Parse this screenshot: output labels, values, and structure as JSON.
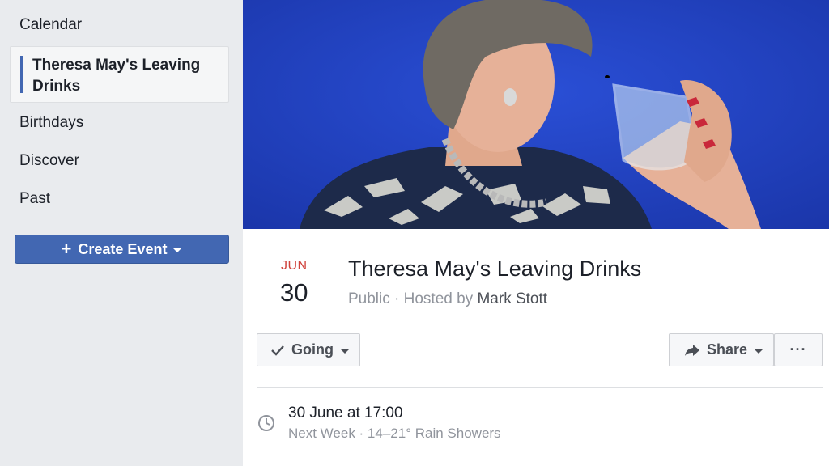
{
  "sidebar": {
    "items": [
      {
        "label": "Calendar"
      },
      {
        "label": "Theresa May's Leaving Drinks"
      },
      {
        "label": "Birthdays"
      },
      {
        "label": "Discover"
      },
      {
        "label": "Past"
      }
    ],
    "create_button": {
      "plus": "+",
      "label": "Create Event"
    }
  },
  "event": {
    "month": "JUN",
    "day": "30",
    "title": "Theresa May's Leaving Drinks",
    "privacy": "Public",
    "hosted_by_prefix": " · Hosted by ",
    "host": "Mark Stott"
  },
  "actions": {
    "going_label": "Going",
    "share_label": "Share",
    "more_label": "···"
  },
  "details": {
    "time": "30 June at 17:00",
    "weather": "Next Week · 14–21° Rain Showers"
  },
  "colors": {
    "accent": "#4267b2",
    "date_red": "#d0423b",
    "cover_blue": "#1f3fbf"
  }
}
